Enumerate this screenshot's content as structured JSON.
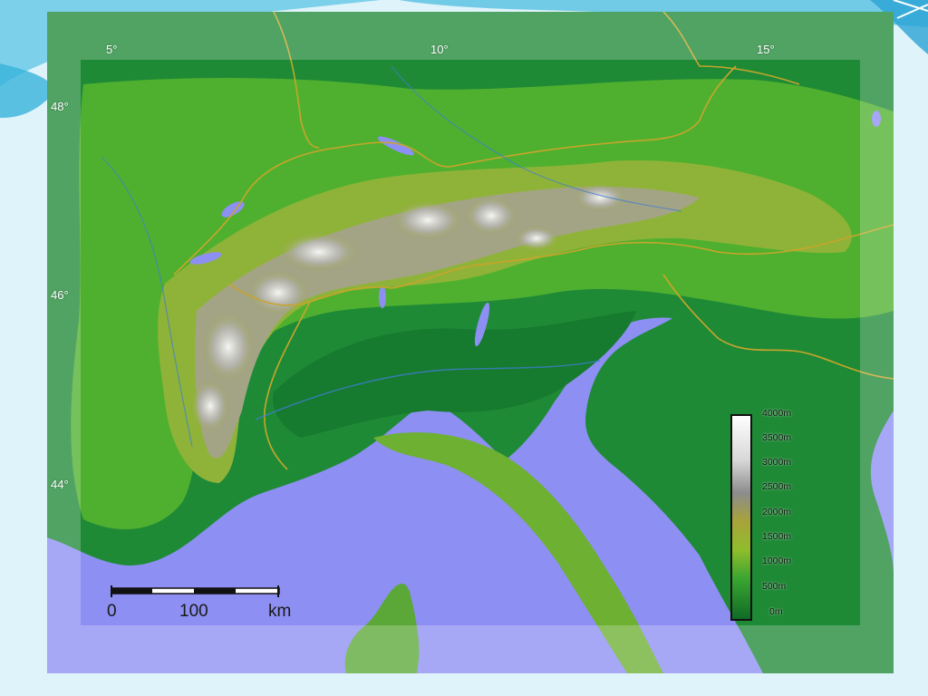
{
  "map": {
    "longitude_labels": [
      "5°",
      "10°",
      "15°"
    ],
    "latitude_labels": [
      "48°",
      "46°",
      "44°"
    ],
    "scale": {
      "start": "0",
      "middle": "100",
      "unit": "km"
    },
    "elevation_legend": [
      "4000m",
      "3500m",
      "3000m",
      "2500m",
      "2000m",
      "1500m",
      "1000m",
      "500m",
      "0m"
    ],
    "colors": {
      "sea": "#8d8ff2",
      "lowland": "#1f8a36",
      "hills": "#5cba2d",
      "mid_elevation": "#a7b43a",
      "high_mountains": "#9a9a9a",
      "peaks": "#ffffff",
      "borders": "#c7a52b"
    }
  }
}
